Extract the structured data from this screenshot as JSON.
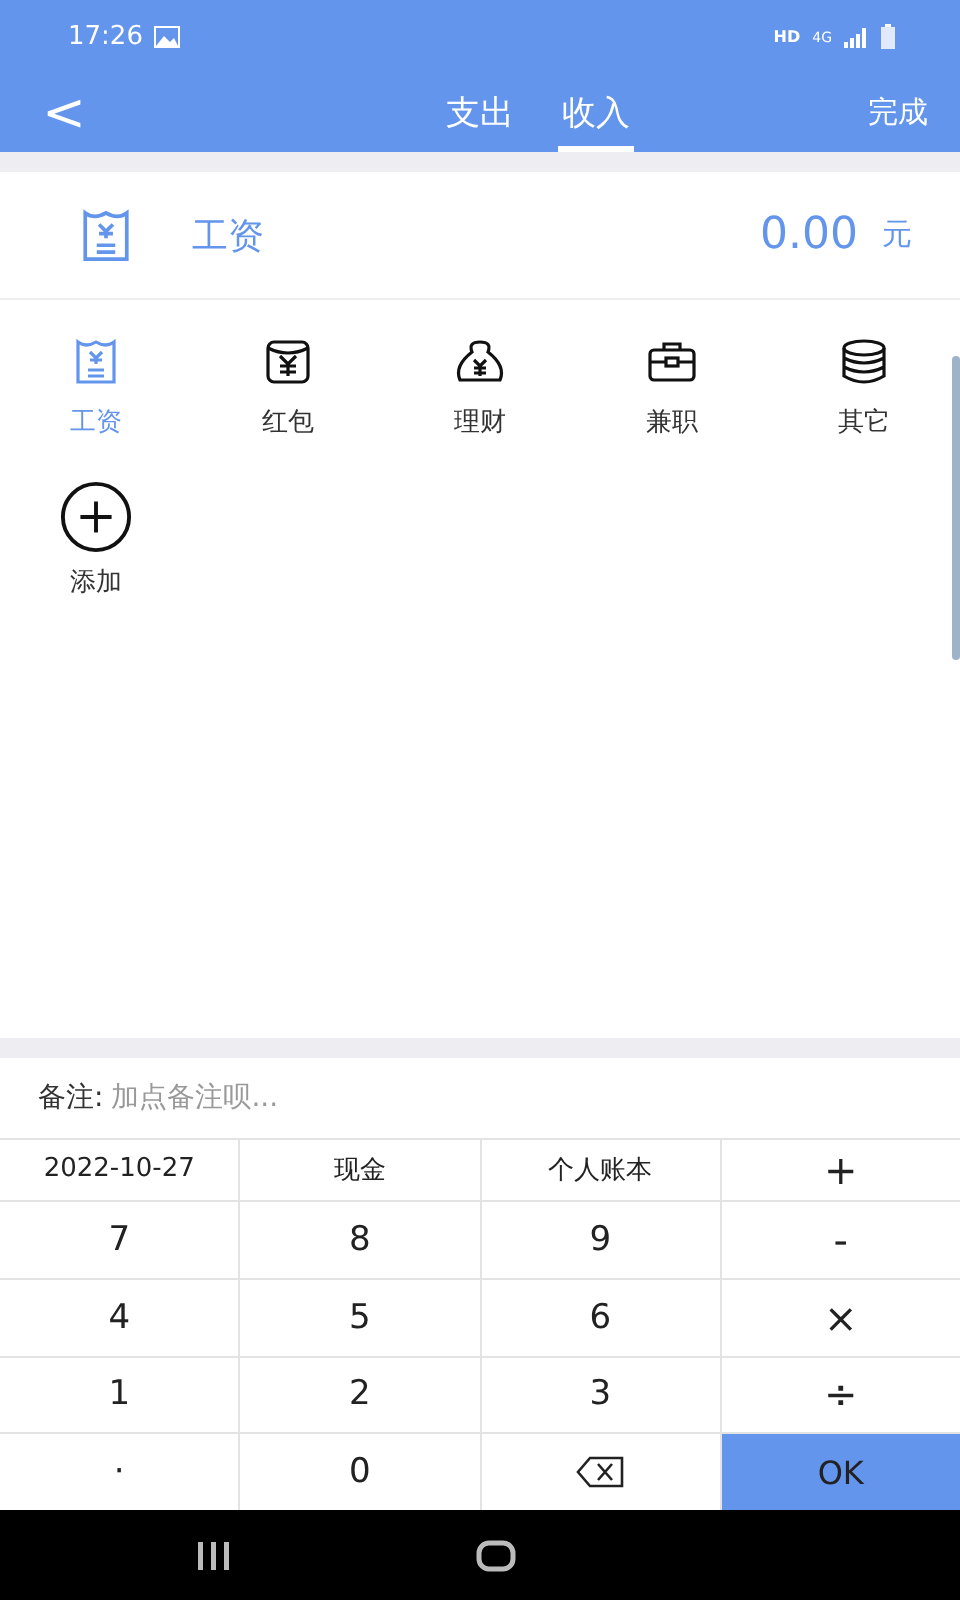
{
  "status_bar": {
    "time": "17:26",
    "hd": "HD",
    "network": "4G"
  },
  "header": {
    "back": "<",
    "tabs": [
      {
        "label": "支出",
        "selected": false
      },
      {
        "label": "收入",
        "selected": true
      }
    ],
    "done": "完成"
  },
  "entry": {
    "category": "工资",
    "amount": "0.00",
    "unit": "元"
  },
  "categories": [
    {
      "label": "工资",
      "kind": "category",
      "selected": true
    },
    {
      "label": "红包",
      "kind": "category",
      "selected": false
    },
    {
      "label": "理财",
      "kind": "category",
      "selected": false
    },
    {
      "label": "兼职",
      "kind": "category",
      "selected": false
    },
    {
      "label": "其它",
      "kind": "category",
      "selected": false
    },
    {
      "label": "添加",
      "kind": "add",
      "selected": false
    }
  ],
  "remark": {
    "label": "备注:",
    "placeholder": "加点备注呗..."
  },
  "keypad": [
    {
      "kind": "text",
      "label": "2022-10-27"
    },
    {
      "kind": "text",
      "label": "现金"
    },
    {
      "kind": "text",
      "label": "个人账本"
    },
    {
      "kind": "op",
      "label": "+"
    },
    {
      "kind": "digit",
      "label": "7"
    },
    {
      "kind": "digit",
      "label": "8"
    },
    {
      "kind": "digit",
      "label": "9"
    },
    {
      "kind": "op",
      "label": "-"
    },
    {
      "kind": "digit",
      "label": "4"
    },
    {
      "kind": "digit",
      "label": "5"
    },
    {
      "kind": "digit",
      "label": "6"
    },
    {
      "kind": "op",
      "label": "×"
    },
    {
      "kind": "digit",
      "label": "1"
    },
    {
      "kind": "digit",
      "label": "2"
    },
    {
      "kind": "digit",
      "label": "3"
    },
    {
      "kind": "op",
      "label": "÷"
    },
    {
      "kind": "digit",
      "label": "·"
    },
    {
      "kind": "digit",
      "label": "0"
    },
    {
      "kind": "backspace"
    },
    {
      "kind": "ok",
      "label": "OK"
    }
  ]
}
